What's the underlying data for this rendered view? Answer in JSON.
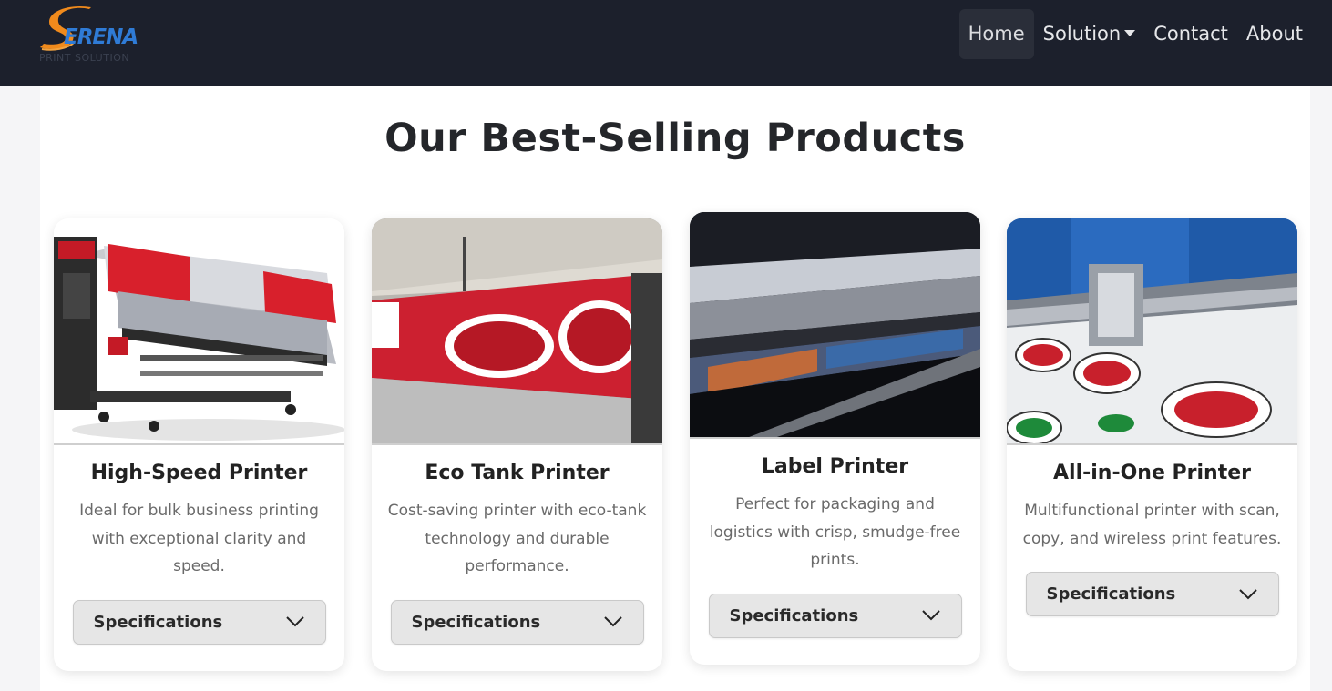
{
  "brand": {
    "name": "ERENA",
    "tagline": "PRINT SOLUTION"
  },
  "nav": {
    "items": [
      {
        "label": "Home",
        "active": true
      },
      {
        "label": "Solution",
        "dropdown": true
      },
      {
        "label": "Contact"
      },
      {
        "label": "About"
      }
    ]
  },
  "section": {
    "title": "Our Best-Selling Products"
  },
  "products": [
    {
      "title": "High-Speed Printer",
      "description": "Ideal for bulk business printing with exceptional clarity and speed.",
      "button": "Specifications",
      "image": "large-format-printer-photo"
    },
    {
      "title": "Eco Tank Printer",
      "description": "Cost-saving printer with eco-tank technology and durable performance.",
      "button": "Specifications",
      "image": "banner-printing-photo"
    },
    {
      "title": "Label Printer",
      "description": "Perfect for packaging and logistics with crisp, smudge-free prints.",
      "button": "Specifications",
      "image": "label-printing-photo"
    },
    {
      "title": "All-in-One Printer",
      "description": "Multifunctional printer with scan, copy, and wireless print features.",
      "button": "Specifications",
      "image": "sticker-printing-photo"
    }
  ],
  "colors": {
    "navbar": "#1c202c",
    "logo_orange": "#f08a1c",
    "logo_blue": "#2f7bd6",
    "button_bg": "#e6e6e6"
  }
}
